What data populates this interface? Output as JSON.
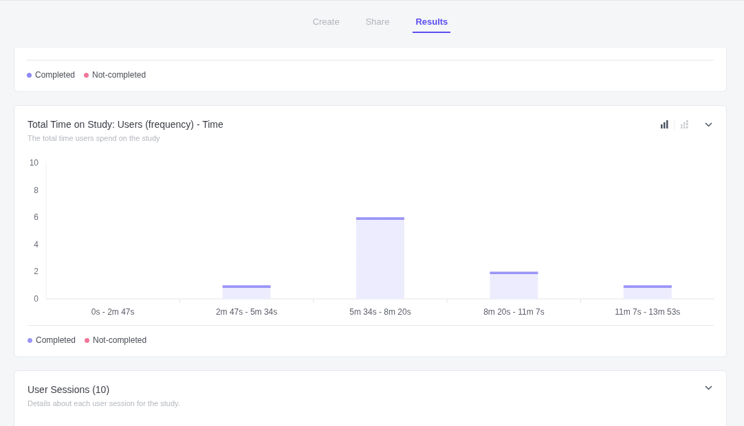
{
  "tabs": [
    {
      "label": "Create",
      "selected": false
    },
    {
      "label": "Share",
      "selected": false
    },
    {
      "label": "Results",
      "selected": true
    }
  ],
  "top_card": {
    "legend": [
      {
        "label": "Completed",
        "color": "#8e8af5"
      },
      {
        "label": "Not-completed",
        "color": "#f0769a"
      }
    ]
  },
  "time_card": {
    "title": "Total Time on Study: Users (frequency) - Time",
    "subtitle": "The total time users spend on the study",
    "view_toggle": [
      {
        "kind": "bar",
        "selected": true
      },
      {
        "kind": "stacked",
        "selected": false
      }
    ],
    "chart_data": {
      "type": "bar",
      "categories": [
        "0s - 2m 47s",
        "2m 47s - 5m 34s",
        "5m 34s - 8m 20s",
        "8m 20s - 11m 7s",
        "11m 7s - 13m 53s"
      ],
      "series": [
        {
          "name": "Completed",
          "color": "#9b96f7",
          "values": [
            0,
            1,
            6,
            2,
            1
          ]
        },
        {
          "name": "Not-completed",
          "color": "#f0769a",
          "values": [
            0,
            0,
            0,
            0,
            0
          ]
        }
      ],
      "ylim": [
        0,
        10
      ],
      "yticks": [
        0,
        2,
        4,
        6,
        8,
        10
      ]
    }
  },
  "sessions_card": {
    "title": "User Sessions (10)",
    "subtitle": "Details about each user session for the study."
  }
}
